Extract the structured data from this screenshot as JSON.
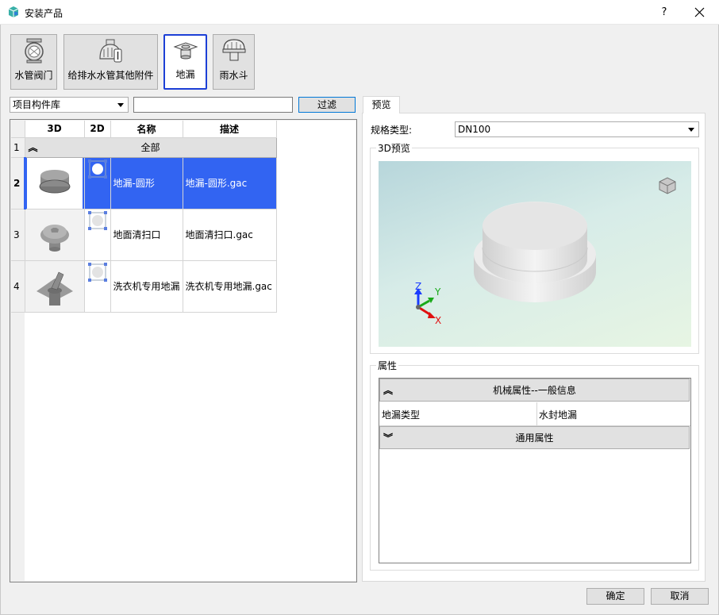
{
  "window": {
    "title": "安装产品",
    "help": "?"
  },
  "categories": [
    {
      "label": "水管阀门",
      "icon": "valve-icon"
    },
    {
      "label": "给排水水管其他附件",
      "icon": "pipe-fitting-icon"
    },
    {
      "label": "地漏",
      "icon": "floor-drain-icon",
      "selected": true
    },
    {
      "label": "雨水斗",
      "icon": "rain-bucket-icon"
    }
  ],
  "library": {
    "selected": "项目构件库",
    "search_value": "",
    "filter_label": "过滤"
  },
  "grid": {
    "headers": [
      "3D",
      "2D",
      "名称",
      "描述"
    ],
    "group": {
      "row": "1",
      "label": "全部"
    },
    "rows": [
      {
        "row": "2",
        "name": "地漏-圆形",
        "desc": "地漏-圆形.gac",
        "selected": true
      },
      {
        "row": "3",
        "name": "地面清扫口",
        "desc": "地面清扫口.gac"
      },
      {
        "row": "4",
        "name": "洗衣机专用地漏",
        "desc": "洗衣机专用地漏.gac"
      }
    ]
  },
  "preview_tab": "预览",
  "spec": {
    "label": "规格类型:",
    "value": "DN100"
  },
  "preview": {
    "title": "3D预览",
    "axes": {
      "z": "Z",
      "y": "Y",
      "x": "X"
    }
  },
  "properties": {
    "title": "属性",
    "group1": "机械属性--一般信息",
    "row_key": "地漏类型",
    "row_value": "水封地漏",
    "group2": "通用属性"
  },
  "buttons": {
    "ok": "确定",
    "cancel": "取消"
  },
  "colors": {
    "selection": "#3264f2",
    "focus": "#1c3fd6"
  }
}
